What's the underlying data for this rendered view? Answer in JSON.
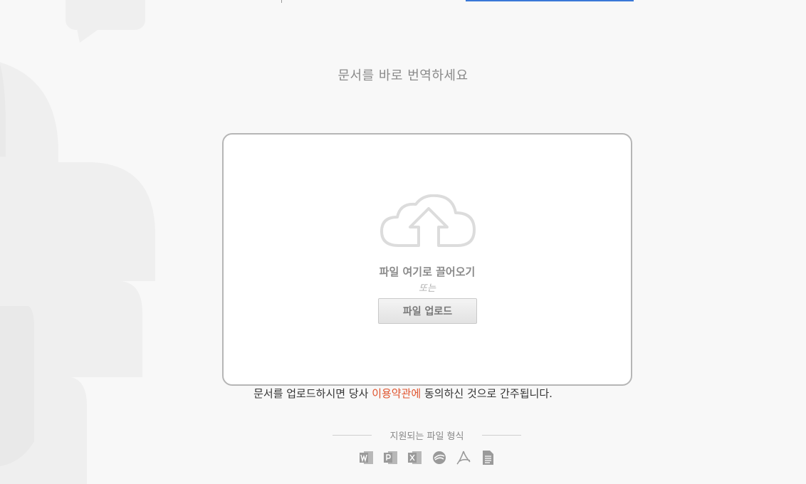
{
  "headline": "문서를 바로 번역하세요",
  "dropzone": {
    "title": "파일 여기로 끌어오기",
    "or": "또는",
    "upload_label": "파일 업로드"
  },
  "terms": {
    "before": "문서를 업로드하시면 당사 ",
    "link": "이용약관에",
    "after": " 동의하신 것으로 간주됩니다."
  },
  "formats": {
    "label": "지원되는 파일 형식",
    "icons": [
      "word-icon",
      "powerpoint-icon",
      "excel-icon",
      "openoffice-icon",
      "pdf-icon",
      "text-file-icon"
    ]
  },
  "colors": {
    "accent_blue": "#3a78d8",
    "link_red": "#e0542e",
    "icon_gray": "#9a9a9a"
  }
}
